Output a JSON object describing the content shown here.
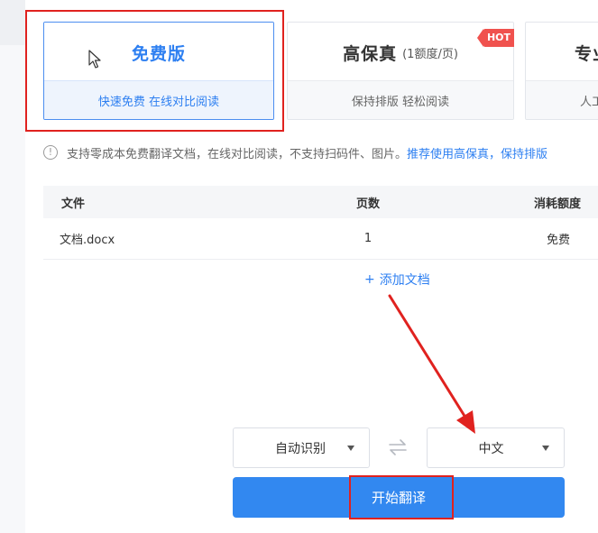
{
  "plans": {
    "free": {
      "name": "免费版",
      "desc": "快速免费 在线对比阅读"
    },
    "high_fidelity": {
      "name": "高保真",
      "note": "(1额度/页)",
      "desc": "保持排版 轻松阅读",
      "badge": "HOT"
    },
    "pro": {
      "name": "专业",
      "desc": "人工"
    }
  },
  "notice": {
    "text": "支持零成本免费翻译文档，在线对比阅读，不支持扫码件、图片。",
    "link": "推荐使用高保真，保持排版"
  },
  "table": {
    "headers": {
      "file": "文件",
      "pages": "页数",
      "cost": "消耗额度"
    },
    "rows": [
      {
        "file": "文档.docx",
        "pages": "1",
        "cost": "免费"
      }
    ]
  },
  "add_document": {
    "plus": "+",
    "label": "添加文档"
  },
  "language": {
    "source": "自动识别",
    "target": "中文"
  },
  "start_button": {
    "label": "开始翻译"
  },
  "colors": {
    "accent": "#2d7ff1",
    "button": "#3288f0",
    "annotation": "#e0221f",
    "hot": "#f0524e"
  }
}
